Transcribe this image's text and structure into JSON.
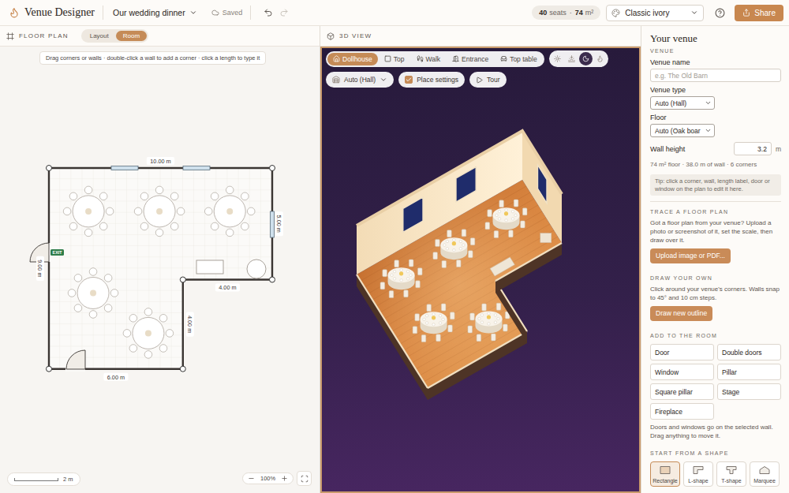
{
  "app": {
    "title": "Venue Designer",
    "project": "Our wedding dinner",
    "save_status": "Saved",
    "history": [
      {
        "kind": "undo",
        "disabled": false
      },
      {
        "kind": "redo",
        "disabled": true
      }
    ],
    "stats": [
      {
        "value": "40",
        "unit": "seats"
      },
      {
        "value": "74",
        "unit": "m²"
      }
    ],
    "stats_separator": "·",
    "theme": "Classic ivory",
    "share": "Share"
  },
  "floor_plan": {
    "title": "FLOOR PLAN",
    "modes": [
      {
        "label": "Layout",
        "selected": false
      },
      {
        "label": "Room",
        "selected": true
      }
    ],
    "hint": "Drag corners or walls · double-click a wall to add a corner · click a length to type it",
    "dimensions": [
      "10.00 m",
      "5.00 m",
      "4.00 m",
      "4.00 m",
      "6.00 m",
      "9.00 m"
    ],
    "exit_sign": "EXIT",
    "scale": "2 m",
    "zoom": "100%"
  },
  "view_3d": {
    "title": "3D VIEW",
    "views": [
      {
        "label": "Dollhouse",
        "selected": true
      },
      {
        "label": "Top",
        "selected": false
      },
      {
        "label": "Walk",
        "selected": false
      },
      {
        "label": "Entrance",
        "selected": false
      },
      {
        "label": "Top table",
        "selected": false
      }
    ],
    "lighting": [
      {
        "kind": "day",
        "selected": false
      },
      {
        "kind": "dusk",
        "selected": false
      },
      {
        "kind": "night",
        "selected": true
      },
      {
        "kind": "candle",
        "selected": false
      }
    ],
    "venue_type": "Auto (Hall)",
    "place_settings": {
      "label": "Place settings",
      "checked": true
    },
    "tour": "Tour"
  },
  "sidebar": {
    "title": "Your venue",
    "section": "VENUE",
    "venue_name": {
      "label": "Venue name",
      "placeholder": "e.g. The Old Barn"
    },
    "venue_type": {
      "label": "Venue type",
      "value": "Auto (Hall)"
    },
    "floor": {
      "label": "Floor",
      "value": "Auto (Oak boar"
    },
    "wall_height": {
      "label": "Wall height",
      "value": "3.2",
      "unit": "m"
    },
    "summary": "74 m² floor · 38.0 m of wall · 6 corners",
    "tip": "Tip: click a corner, wall, length label, door or window on the plan to edit it here.",
    "trace": {
      "title": "TRACE A FLOOR PLAN",
      "text": "Got a floor plan from your venue? Upload a photo or screenshot of it, set the scale, then draw over it.",
      "button": "Upload image or PDF..."
    },
    "draw": {
      "title": "DRAW YOUR OWN",
      "text": "Click around your venue's corners. Walls snap to 45° and 10 cm steps.",
      "button": "Draw new outline"
    },
    "add": {
      "title": "ADD TO THE ROOM",
      "items": [
        "Door",
        "Double doors",
        "Window",
        "Pillar",
        "Square pillar",
        "Stage",
        "Fireplace"
      ],
      "note": "Doors and windows go on the selected wall. Drag anything to move it."
    },
    "shapes": {
      "title": "START FROM A SHAPE",
      "items": [
        {
          "label": "Rectangle",
          "selected": true
        },
        {
          "label": "L-shape",
          "selected": false
        },
        {
          "label": "T-shape",
          "selected": false
        },
        {
          "label": "Marquee",
          "selected": false
        }
      ]
    }
  }
}
